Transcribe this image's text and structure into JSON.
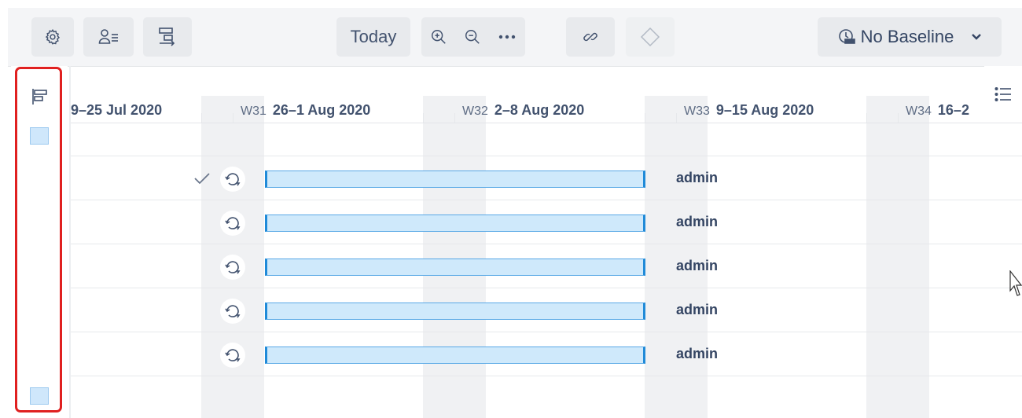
{
  "toolbar": {
    "settings_icon": "gear-icon",
    "users_icon": "user-list-icon",
    "hierarchy_icon": "hierarchy-icon",
    "today_label": "Today",
    "zoom_in_icon": "zoom-in-icon",
    "zoom_out_icon": "zoom-out-icon",
    "more_icon": "more-icon",
    "link_icon": "link-icon",
    "milestone_icon": "diamond-icon",
    "baseline_label": "No Baseline",
    "baseline_icon": "baseline-icon"
  },
  "timeline": {
    "weeks": [
      {
        "num": "",
        "range": "9–25 Jul 2020"
      },
      {
        "num": "W31",
        "range": "26–1 Aug 2020"
      },
      {
        "num": "W32",
        "range": "2–8 Aug 2020"
      },
      {
        "num": "W33",
        "range": "9–15 Aug 2020"
      },
      {
        "num": "W34",
        "range": "16–2"
      }
    ]
  },
  "rows": [
    {
      "assignee": "admin",
      "completed": true
    },
    {
      "assignee": "admin",
      "completed": false
    },
    {
      "assignee": "admin",
      "completed": false
    },
    {
      "assignee": "admin",
      "completed": false
    },
    {
      "assignee": "admin",
      "completed": false
    }
  ],
  "colors": {
    "bar_fill": "#cfe9fb",
    "bar_border": "#1f8ad8",
    "highlight": "#e02020"
  }
}
